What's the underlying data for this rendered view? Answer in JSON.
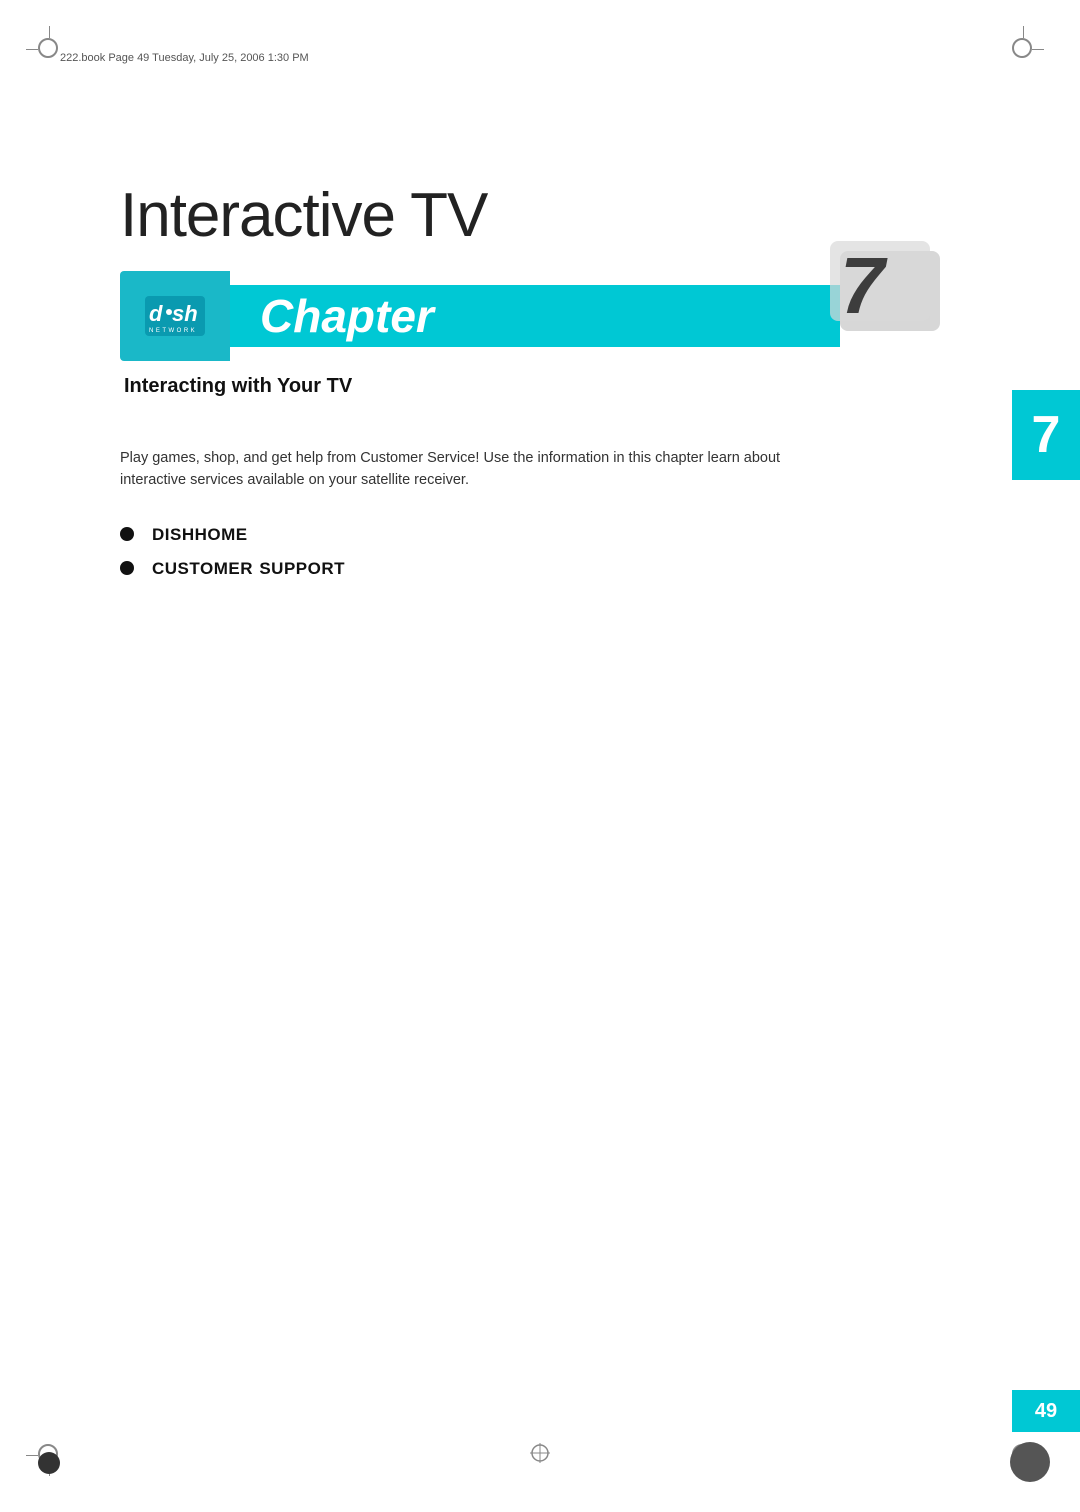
{
  "meta": {
    "file_info": "222.book  Page 49  Tuesday, July 25, 2006  1:30 PM"
  },
  "chapter": {
    "title": "Interactive TV",
    "banner_label": "Chapter",
    "number": "7",
    "subtitle": "Interacting with Your TV",
    "description": "Play games, shop, and get help from Customer Service! Use the information in this chapter learn about interactive services available on your satellite receiver.",
    "bullet_items": [
      {
        "id": "dishhome",
        "text": "DishHome"
      },
      {
        "id": "customer-support",
        "text": "Customer Support"
      }
    ]
  },
  "page": {
    "number": "49"
  },
  "logo": {
    "brand": "dish",
    "sub": "NETWORK"
  },
  "colors": {
    "cyan": "#00c8d4",
    "dark": "#111111",
    "white": "#ffffff"
  }
}
